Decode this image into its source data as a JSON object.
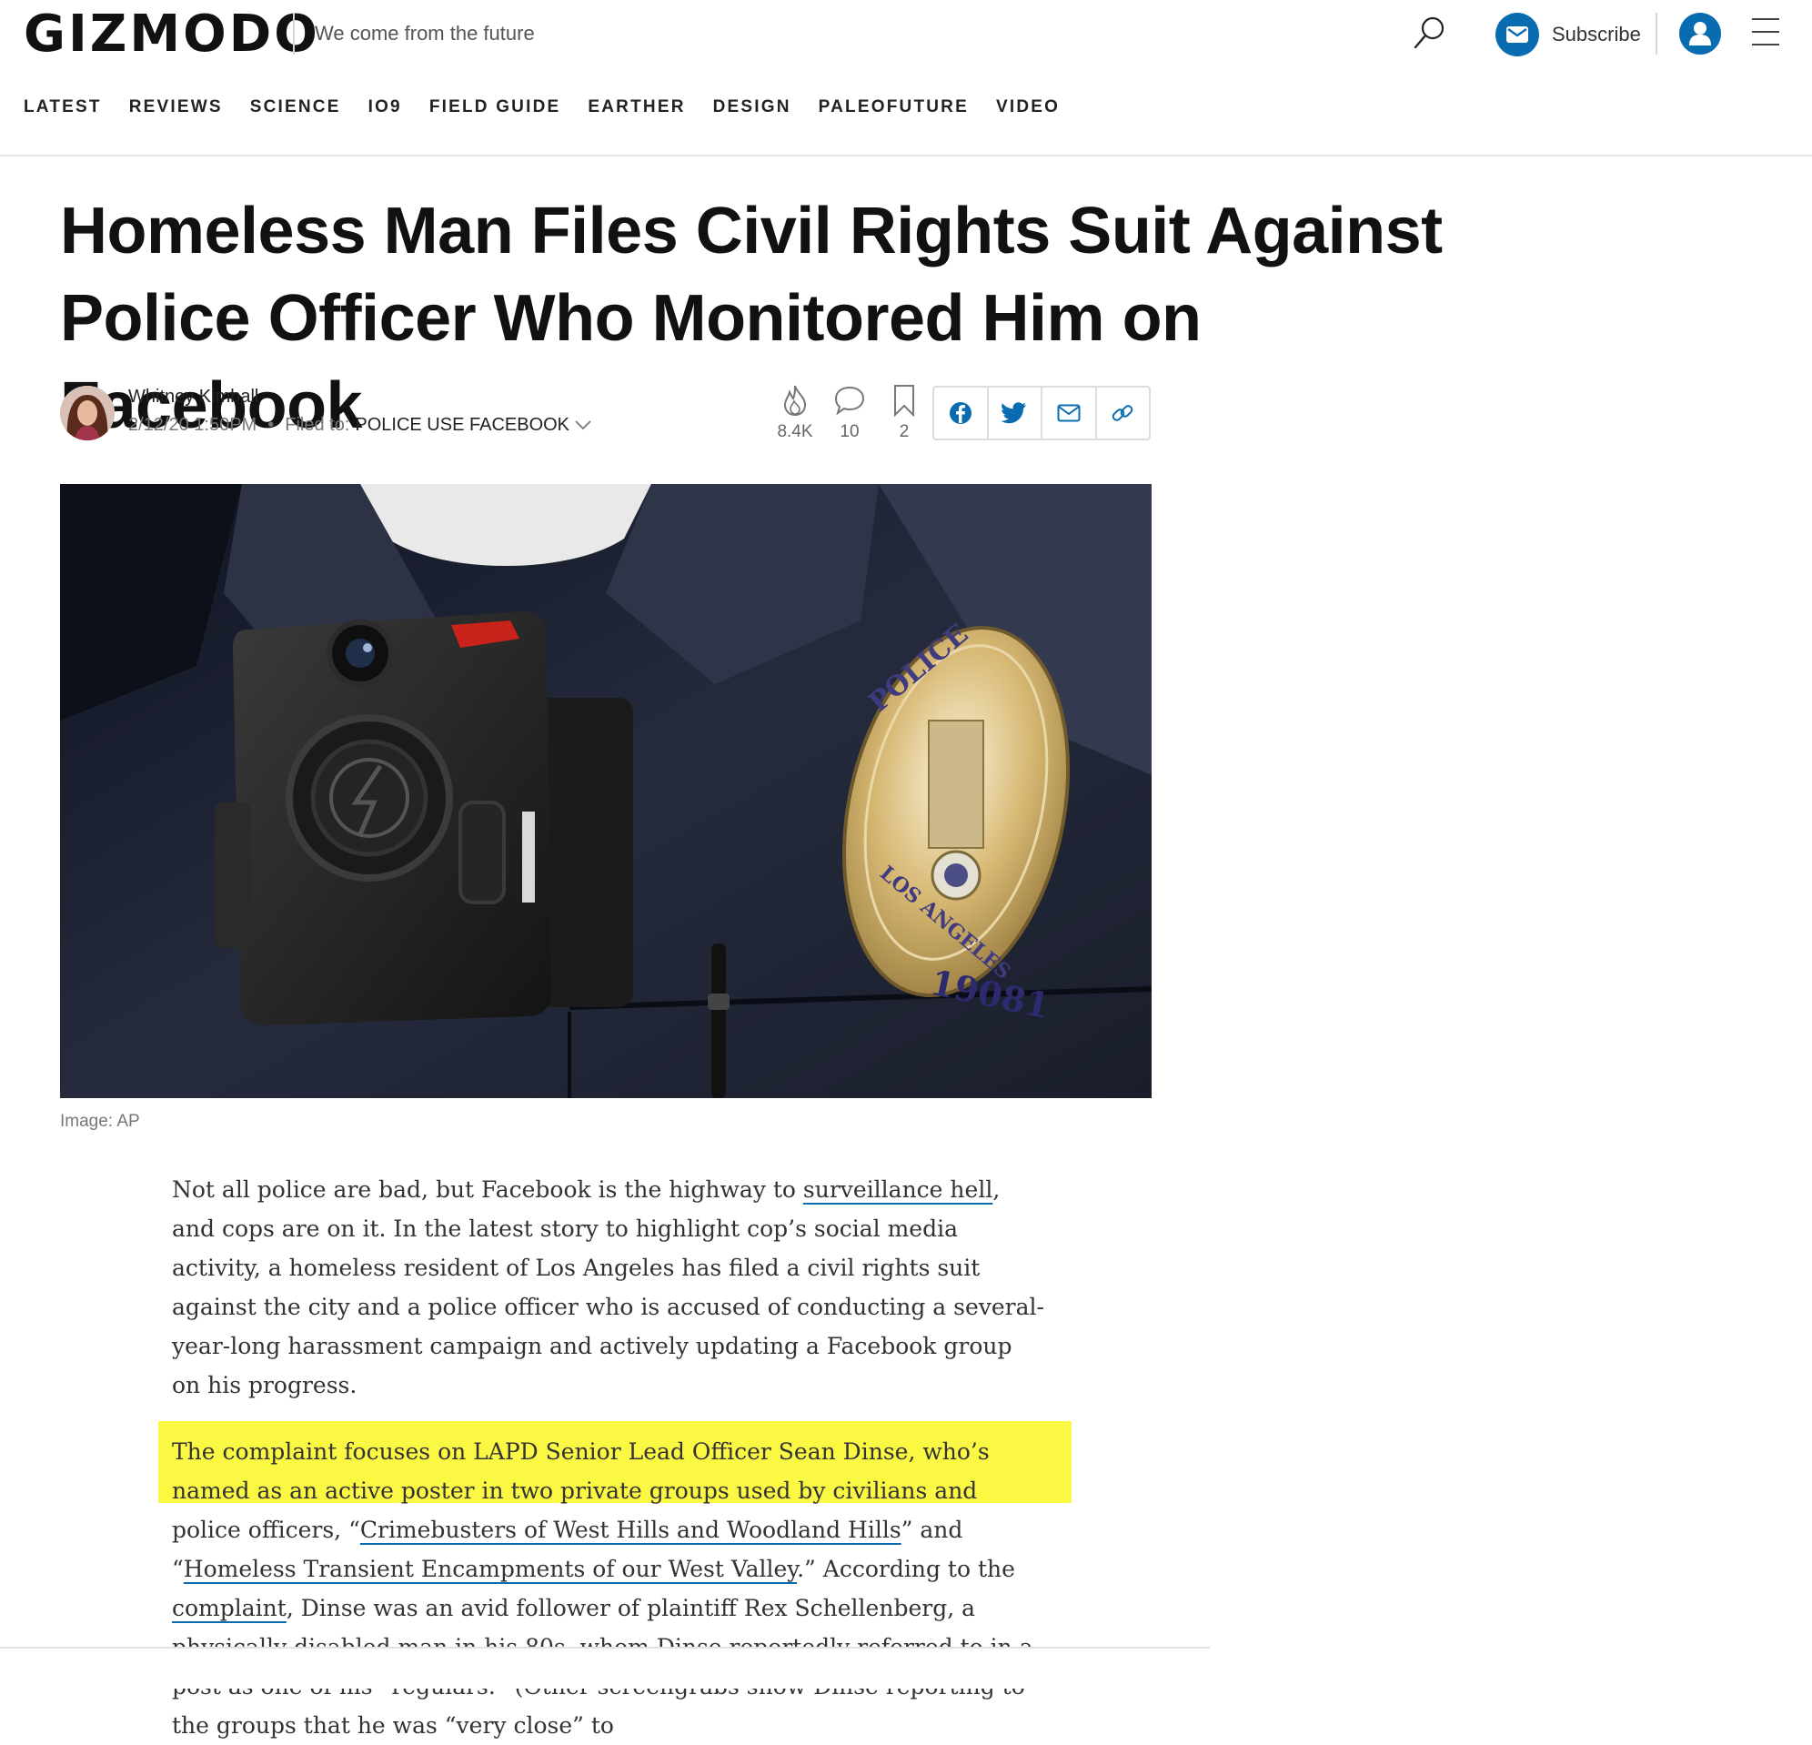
{
  "header": {
    "logo": "GIZMODO",
    "tagline": "We come from the future",
    "subscribe_label": "Subscribe",
    "brand_color": "#0a6cb0"
  },
  "nav": {
    "items": [
      "LATEST",
      "REVIEWS",
      "SCIENCE",
      "IO9",
      "FIELD GUIDE",
      "EARTHER",
      "DESIGN",
      "PALEOFUTURE",
      "VIDEO"
    ]
  },
  "article": {
    "headline": "Homeless Man Files Civil Rights Suit Against Police Officer Who Monitored Him on Facebook",
    "author": "Whitney Kimball",
    "date": "2/12/20 1:50PM",
    "filed_to_label": "Filed to:",
    "filed_to_tag": "POLICE USE FACEBOOK",
    "stats": {
      "reactions": "8.4K",
      "comments": "10",
      "saves": "2"
    },
    "image_caption": "Image: AP",
    "badge_text": "19081",
    "highlight_color": "#fbf844",
    "p1": {
      "a": "Not all police are bad, but Facebook is the highway to ",
      "link1": "surveillance hell",
      "b": ", and cops are on it. In the latest story to highlight cop’s social media activity, a homeless resident of Los Angeles has filed a civil rights suit against the city and a police officer who is accused of conducting a several-year-long harassment campaign and actively updating a Facebook group on his progress."
    },
    "p2": {
      "a": "The complaint focuses on LAPD Senior Lead Officer Sean Dinse, who’s named as an active poster in two private groups used by civilians and police officers, “",
      "link1": "Crimebusters of West Hills and Woodland Hills",
      "b": "” and “",
      "link2": "Homeless Transient Encampments of our West Valley",
      "c": ".” According to the ",
      "link3": "complaint",
      "d": ", Dinse was an avid follower of plaintiff Rex Schellenberg, a physically disabled man in his 80s, whom Dinse reportedly referred to in a post as one of his “regulars.” (Other screengrabs show Dinse reporting to the groups that he was “very close” to"
    }
  }
}
